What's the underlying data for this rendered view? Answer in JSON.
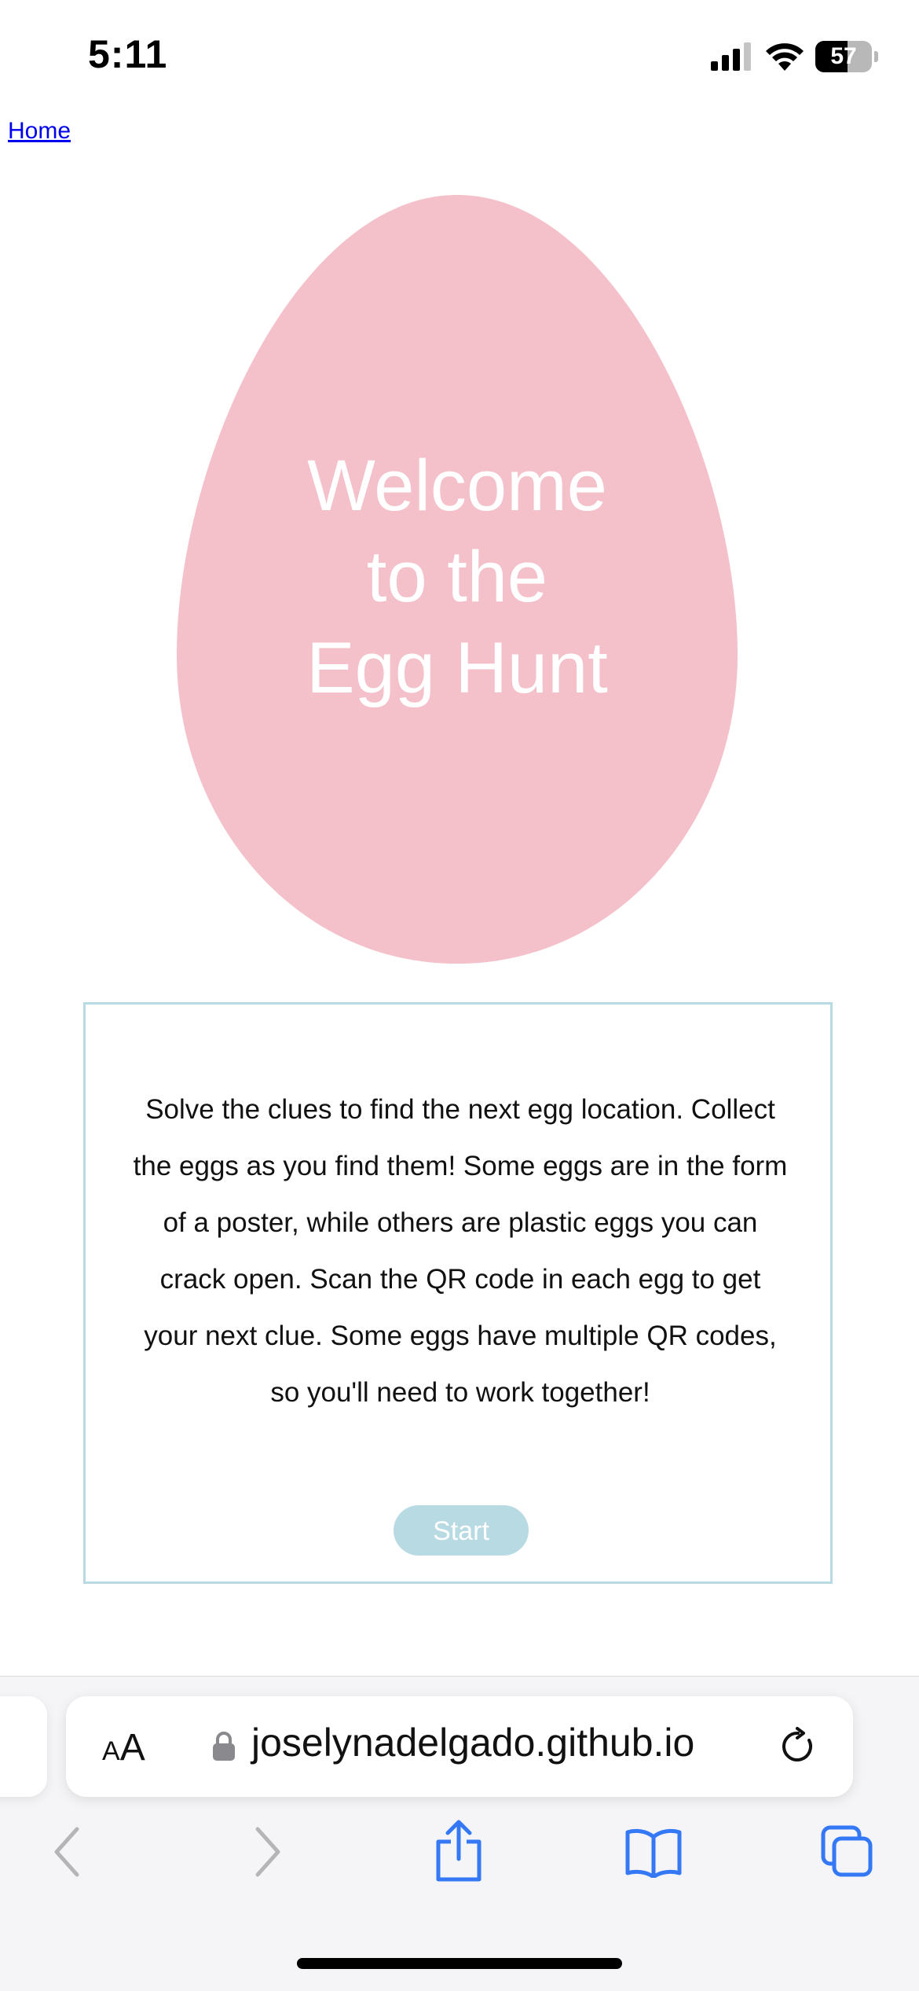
{
  "status_bar": {
    "time": "5:11",
    "battery_level": "57",
    "battery_fraction": 0.57,
    "icons": [
      "signal-icon",
      "wifi-icon",
      "battery-icon"
    ]
  },
  "page": {
    "home_link": "Home",
    "egg_title": [
      "Welcome",
      "to the",
      "Egg Hunt"
    ],
    "description": "Solve the clues to find the next egg location. Collect the eggs as you find them! Some eggs are in the form of a poster, while others are plastic eggs you can crack open. Scan the QR code in each egg to get your next clue. Some eggs have multiple QR codes, so you'll need to work together!",
    "start_button": "Start"
  },
  "browser": {
    "text_size_label": "AA",
    "url": "joselynadelgado.github.io",
    "icons": [
      "lock-icon",
      "reload-icon",
      "back-icon",
      "forward-icon",
      "share-icon",
      "bookmarks-icon",
      "tabs-icon"
    ]
  },
  "colors": {
    "egg": "#f4c0ca",
    "accent": "#b8dae3",
    "link": "#0000ee",
    "ios_blue": "#3478f6"
  }
}
